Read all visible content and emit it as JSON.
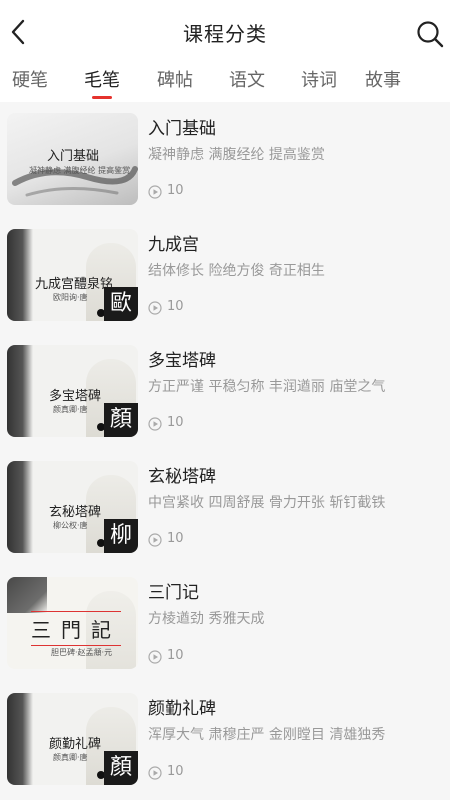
{
  "header": {
    "title": "课程分类"
  },
  "tabs": [
    {
      "label": "硬笔"
    },
    {
      "label": "毛笔"
    },
    {
      "label": "碑帖"
    },
    {
      "label": "语文"
    },
    {
      "label": "诗词"
    },
    {
      "label": "故事"
    }
  ],
  "active_tab": "毛笔",
  "accent_color": "#e5322d",
  "courses": [
    {
      "title": "入门基础",
      "desc": "凝神静虑 满腹经纶 提高鉴赏",
      "count": "10",
      "thumb": {
        "title": "入门基础",
        "sub": "凝神静虑 满腹经纶 提高鉴赏",
        "seal": ""
      }
    },
    {
      "title": "九成宫",
      "desc": "结体修长 险绝方俊 奇正相生",
      "count": "10",
      "thumb": {
        "title": "九成宫醴泉铭",
        "sub": "欧阳询·唐",
        "seal": "歐"
      }
    },
    {
      "title": "多宝塔碑",
      "desc": "方正严谨 平稳匀称 丰润遒丽 庙堂之气",
      "count": "10",
      "thumb": {
        "title": "多宝塔碑",
        "sub": "颜真卿·唐",
        "seal": "顏"
      }
    },
    {
      "title": "玄秘塔碑",
      "desc": "中宫紧收 四周舒展 骨力开张 斩钉截铁",
      "count": "10",
      "thumb": {
        "title": "玄秘塔碑",
        "sub": "柳公权·唐",
        "seal": "柳"
      }
    },
    {
      "title": "三门记",
      "desc": "方棱遒劲 秀雅天成",
      "count": "10",
      "thumb": {
        "title": "三門記",
        "sub": "胆巴碑·赵孟頫·元",
        "seal": ""
      }
    },
    {
      "title": "颜勤礼碑",
      "desc": "浑厚大气 肃穆庄严 金刚瞠目 清雄独秀",
      "count": "10",
      "thumb": {
        "title": "颜勤礼碑",
        "sub": "颜真卿·唐",
        "seal": "顏"
      }
    }
  ]
}
